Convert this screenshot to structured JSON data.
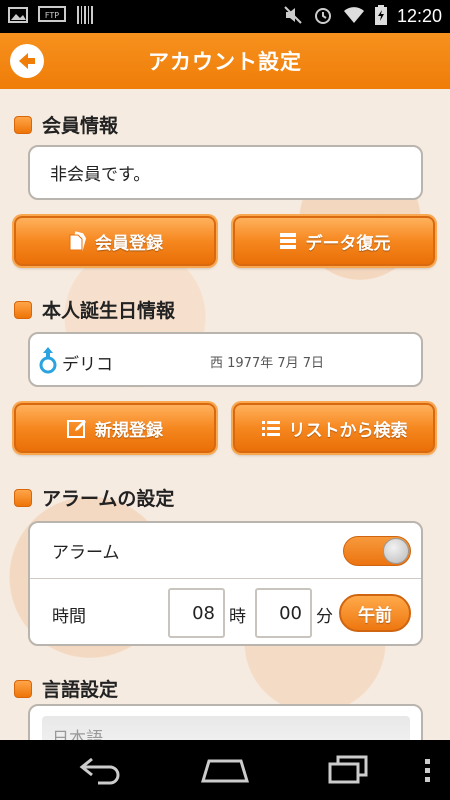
{
  "status_bar": {
    "time": "12:20",
    "left_icons": [
      "image-icon",
      "ftp-icon",
      "barcode-icon"
    ],
    "right_icons": [
      "mute-icon",
      "alarm-icon",
      "wifi-icon",
      "battery-icon"
    ]
  },
  "header": {
    "title": "アカウント設定",
    "back_icon": "back-arrow-icon"
  },
  "member": {
    "section_title": "会員情報",
    "status_text": "非会員です。",
    "register_label": "会員登録",
    "restore_label": "データ復元"
  },
  "birthday": {
    "section_title": "本人誕生日情報",
    "gender_icon": "male-symbol-icon",
    "name": "デリコ",
    "date": "西 1977年 7月 7日",
    "new_register_label": "新規登録",
    "list_search_label": "リストから検索"
  },
  "alarm": {
    "section_title": "アラームの設定",
    "alarm_label": "アラーム",
    "toggle_on": true,
    "time_label": "時間",
    "hour_value": "08",
    "hour_unit": "時",
    "minute_value": "00",
    "minute_unit": "分",
    "am_pm_label": "午前"
  },
  "language": {
    "section_title": "言語設定",
    "selected": "日本語"
  },
  "colors": {
    "accent": "#f28613",
    "header": "#ef7d08"
  }
}
